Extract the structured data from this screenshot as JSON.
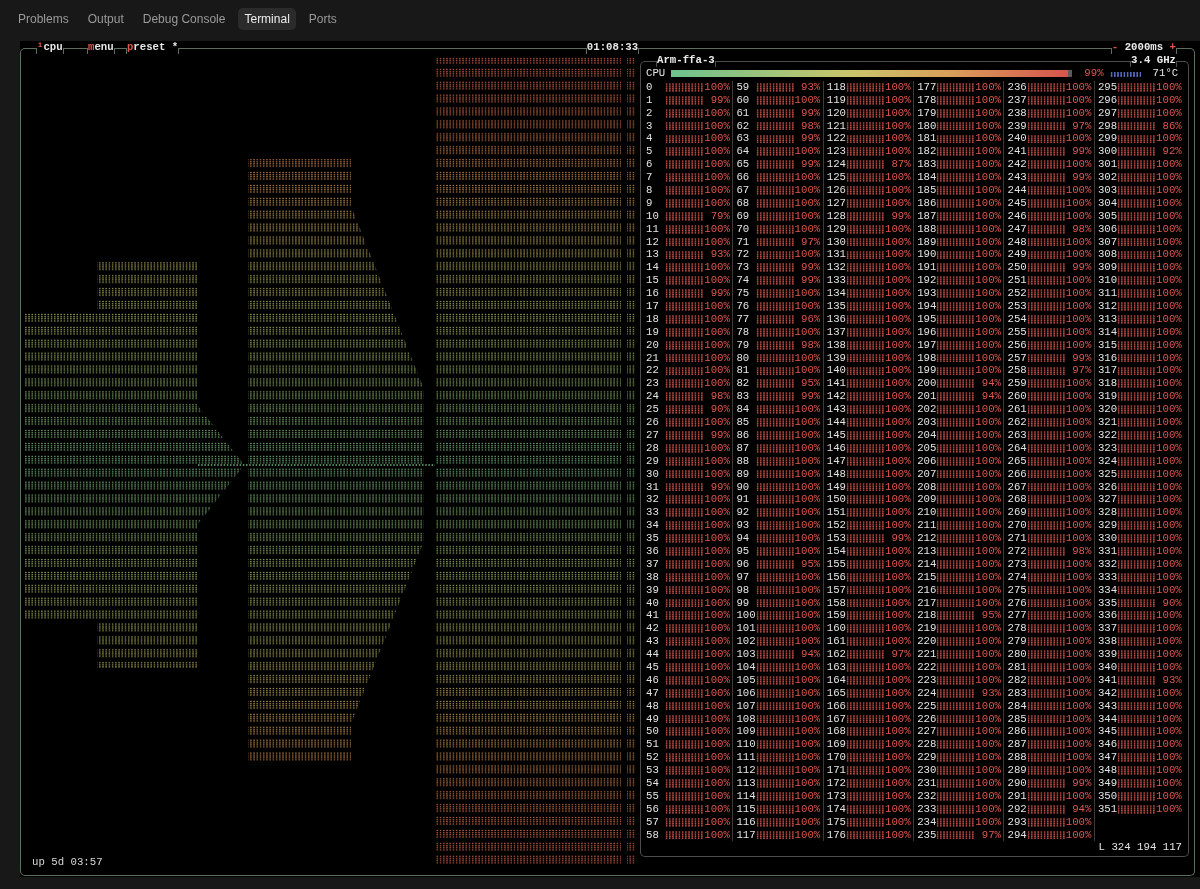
{
  "panel_tabs": [
    {
      "label": "Problems",
      "selected": false
    },
    {
      "label": "Output",
      "selected": false
    },
    {
      "label": "Debug Console",
      "selected": false
    },
    {
      "label": "Terminal",
      "selected": true
    },
    {
      "label": "Ports",
      "selected": false
    }
  ],
  "btop": {
    "title_tabs": [
      {
        "label": "¹cpu"
      },
      {
        "label": "menu"
      },
      {
        "label": "preset *"
      }
    ],
    "clock": "01:08:33",
    "update_interval": {
      "decrease": "-",
      "value": "2000ms",
      "increase": "+"
    },
    "uptime": "up 5d 03:57",
    "cpu_box": {
      "title": "Arm-ffa-3",
      "frequency": "3.4 GHz",
      "total": {
        "label": "CPU",
        "level": 0.99,
        "reading": "99%",
        "temperature": "71°C"
      },
      "cores": [
        {
          "label": "0",
          "reading": "100%"
        },
        {
          "label": "1",
          "reading": "99%"
        },
        {
          "label": "2",
          "reading": "100%"
        },
        {
          "label": "3",
          "reading": "100%"
        },
        {
          "label": "4",
          "reading": "100%"
        },
        {
          "label": "5",
          "reading": "100%"
        },
        {
          "label": "6",
          "reading": "100%"
        },
        {
          "label": "7",
          "reading": "100%"
        },
        {
          "label": "8",
          "reading": "100%"
        },
        {
          "label": "9",
          "reading": "100%"
        },
        {
          "label": "10",
          "reading": "79%"
        },
        {
          "label": "11",
          "reading": "100%"
        },
        {
          "label": "12",
          "reading": "100%"
        },
        {
          "label": "13",
          "reading": "93%"
        },
        {
          "label": "14",
          "reading": "100%"
        },
        {
          "label": "15",
          "reading": "100%"
        },
        {
          "label": "16",
          "reading": "99%"
        },
        {
          "label": "17",
          "reading": "100%"
        },
        {
          "label": "18",
          "reading": "100%"
        },
        {
          "label": "19",
          "reading": "100%"
        },
        {
          "label": "20",
          "reading": "100%"
        },
        {
          "label": "21",
          "reading": "100%"
        },
        {
          "label": "22",
          "reading": "100%"
        },
        {
          "label": "23",
          "reading": "100%"
        },
        {
          "label": "24",
          "reading": "98%"
        },
        {
          "label": "25",
          "reading": "90%"
        },
        {
          "label": "26",
          "reading": "100%"
        },
        {
          "label": "27",
          "reading": "99%"
        },
        {
          "label": "28",
          "reading": "100%"
        },
        {
          "label": "29",
          "reading": "100%"
        },
        {
          "label": "30",
          "reading": "100%"
        },
        {
          "label": "31",
          "reading": "99%"
        },
        {
          "label": "32",
          "reading": "100%"
        },
        {
          "label": "33",
          "reading": "100%"
        },
        {
          "label": "34",
          "reading": "100%"
        },
        {
          "label": "35",
          "reading": "100%"
        },
        {
          "label": "36",
          "reading": "100%"
        },
        {
          "label": "37",
          "reading": "100%"
        },
        {
          "label": "38",
          "reading": "100%"
        },
        {
          "label": "39",
          "reading": "100%"
        },
        {
          "label": "40",
          "reading": "100%"
        },
        {
          "label": "41",
          "reading": "100%"
        },
        {
          "label": "42",
          "reading": "100%"
        },
        {
          "label": "43",
          "reading": "100%"
        },
        {
          "label": "44",
          "reading": "100%"
        },
        {
          "label": "45",
          "reading": "100%"
        },
        {
          "label": "46",
          "reading": "100%"
        },
        {
          "label": "47",
          "reading": "100%"
        },
        {
          "label": "48",
          "reading": "100%"
        },
        {
          "label": "49",
          "reading": "100%"
        },
        {
          "label": "50",
          "reading": "100%"
        },
        {
          "label": "51",
          "reading": "100%"
        },
        {
          "label": "52",
          "reading": "100%"
        },
        {
          "label": "53",
          "reading": "100%"
        },
        {
          "label": "54",
          "reading": "100%"
        },
        {
          "label": "55",
          "reading": "100%"
        },
        {
          "label": "56",
          "reading": "100%"
        },
        {
          "label": "57",
          "reading": "100%"
        },
        {
          "label": "58",
          "reading": "100%"
        },
        {
          "label": "59",
          "reading": "93%"
        },
        {
          "label": "60",
          "reading": "100%"
        },
        {
          "label": "61",
          "reading": "99%"
        },
        {
          "label": "62",
          "reading": "98%"
        },
        {
          "label": "63",
          "reading": "99%"
        },
        {
          "label": "64",
          "reading": "100%"
        },
        {
          "label": "65",
          "reading": "99%"
        },
        {
          "label": "66",
          "reading": "100%"
        },
        {
          "label": "67",
          "reading": "100%"
        },
        {
          "label": "68",
          "reading": "100%"
        },
        {
          "label": "69",
          "reading": "100%"
        },
        {
          "label": "70",
          "reading": "100%"
        },
        {
          "label": "71",
          "reading": "97%"
        },
        {
          "label": "72",
          "reading": "100%"
        },
        {
          "label": "73",
          "reading": "99%"
        },
        {
          "label": "74",
          "reading": "99%"
        },
        {
          "label": "75",
          "reading": "100%"
        },
        {
          "label": "76",
          "reading": "100%"
        },
        {
          "label": "77",
          "reading": "96%"
        },
        {
          "label": "78",
          "reading": "100%"
        },
        {
          "label": "79",
          "reading": "98%"
        },
        {
          "label": "80",
          "reading": "100%"
        },
        {
          "label": "81",
          "reading": "100%"
        },
        {
          "label": "82",
          "reading": "95%"
        },
        {
          "label": "83",
          "reading": "99%"
        },
        {
          "label": "84",
          "reading": "100%"
        },
        {
          "label": "85",
          "reading": "100%"
        },
        {
          "label": "86",
          "reading": "100%"
        },
        {
          "label": "87",
          "reading": "100%"
        },
        {
          "label": "88",
          "reading": "100%"
        },
        {
          "label": "89",
          "reading": "100%"
        },
        {
          "label": "90",
          "reading": "100%"
        },
        {
          "label": "91",
          "reading": "100%"
        },
        {
          "label": "92",
          "reading": "100%"
        },
        {
          "label": "93",
          "reading": "100%"
        },
        {
          "label": "94",
          "reading": "100%"
        },
        {
          "label": "95",
          "reading": "100%"
        },
        {
          "label": "96",
          "reading": "95%"
        },
        {
          "label": "97",
          "reading": "100%"
        },
        {
          "label": "98",
          "reading": "100%"
        },
        {
          "label": "99",
          "reading": "100%"
        },
        {
          "label": "100",
          "reading": "100%"
        },
        {
          "label": "101",
          "reading": "100%"
        },
        {
          "label": "102",
          "reading": "100%"
        },
        {
          "label": "103",
          "reading": "94%"
        },
        {
          "label": "104",
          "reading": "100%"
        },
        {
          "label": "105",
          "reading": "100%"
        },
        {
          "label": "106",
          "reading": "100%"
        },
        {
          "label": "107",
          "reading": "100%"
        },
        {
          "label": "108",
          "reading": "100%"
        },
        {
          "label": "109",
          "reading": "100%"
        },
        {
          "label": "110",
          "reading": "100%"
        },
        {
          "label": "111",
          "reading": "100%"
        },
        {
          "label": "112",
          "reading": "100%"
        },
        {
          "label": "113",
          "reading": "100%"
        },
        {
          "label": "114",
          "reading": "100%"
        },
        {
          "label": "115",
          "reading": "100%"
        },
        {
          "label": "116",
          "reading": "100%"
        },
        {
          "label": "117",
          "reading": "100%"
        },
        {
          "label": "118",
          "reading": "100%"
        },
        {
          "label": "119",
          "reading": "100%"
        },
        {
          "label": "120",
          "reading": "100%"
        },
        {
          "label": "121",
          "reading": "100%"
        },
        {
          "label": "122",
          "reading": "100%"
        },
        {
          "label": "123",
          "reading": "100%"
        },
        {
          "label": "124",
          "reading": "87%"
        },
        {
          "label": "125",
          "reading": "100%"
        },
        {
          "label": "126",
          "reading": "100%"
        },
        {
          "label": "127",
          "reading": "100%"
        },
        {
          "label": "128",
          "reading": "99%"
        },
        {
          "label": "129",
          "reading": "100%"
        },
        {
          "label": "130",
          "reading": "100%"
        },
        {
          "label": "131",
          "reading": "100%"
        },
        {
          "label": "132",
          "reading": "100%"
        },
        {
          "label": "133",
          "reading": "100%"
        },
        {
          "label": "134",
          "reading": "100%"
        },
        {
          "label": "135",
          "reading": "100%"
        },
        {
          "label": "136",
          "reading": "100%"
        },
        {
          "label": "137",
          "reading": "100%"
        },
        {
          "label": "138",
          "reading": "100%"
        },
        {
          "label": "139",
          "reading": "100%"
        },
        {
          "label": "140",
          "reading": "100%"
        },
        {
          "label": "141",
          "reading": "100%"
        },
        {
          "label": "142",
          "reading": "100%"
        },
        {
          "label": "143",
          "reading": "100%"
        },
        {
          "label": "144",
          "reading": "100%"
        },
        {
          "label": "145",
          "reading": "100%"
        },
        {
          "label": "146",
          "reading": "100%"
        },
        {
          "label": "147",
          "reading": "100%"
        },
        {
          "label": "148",
          "reading": "100%"
        },
        {
          "label": "149",
          "reading": "100%"
        },
        {
          "label": "150",
          "reading": "100%"
        },
        {
          "label": "151",
          "reading": "100%"
        },
        {
          "label": "152",
          "reading": "100%"
        },
        {
          "label": "153",
          "reading": "99%"
        },
        {
          "label": "154",
          "reading": "100%"
        },
        {
          "label": "155",
          "reading": "100%"
        },
        {
          "label": "156",
          "reading": "100%"
        },
        {
          "label": "157",
          "reading": "100%"
        },
        {
          "label": "158",
          "reading": "100%"
        },
        {
          "label": "159",
          "reading": "100%"
        },
        {
          "label": "160",
          "reading": "100%"
        },
        {
          "label": "161",
          "reading": "100%"
        },
        {
          "label": "162",
          "reading": "97%"
        },
        {
          "label": "163",
          "reading": "100%"
        },
        {
          "label": "164",
          "reading": "100%"
        },
        {
          "label": "165",
          "reading": "100%"
        },
        {
          "label": "166",
          "reading": "100%"
        },
        {
          "label": "167",
          "reading": "100%"
        },
        {
          "label": "168",
          "reading": "100%"
        },
        {
          "label": "169",
          "reading": "100%"
        },
        {
          "label": "170",
          "reading": "100%"
        },
        {
          "label": "171",
          "reading": "100%"
        },
        {
          "label": "172",
          "reading": "100%"
        },
        {
          "label": "173",
          "reading": "100%"
        },
        {
          "label": "174",
          "reading": "100%"
        },
        {
          "label": "175",
          "reading": "100%"
        },
        {
          "label": "176",
          "reading": "100%"
        },
        {
          "label": "177",
          "reading": "100%"
        },
        {
          "label": "178",
          "reading": "100%"
        },
        {
          "label": "179",
          "reading": "100%"
        },
        {
          "label": "180",
          "reading": "100%"
        },
        {
          "label": "181",
          "reading": "100%"
        },
        {
          "label": "182",
          "reading": "100%"
        },
        {
          "label": "183",
          "reading": "100%"
        },
        {
          "label": "184",
          "reading": "100%"
        },
        {
          "label": "185",
          "reading": "100%"
        },
        {
          "label": "186",
          "reading": "100%"
        },
        {
          "label": "187",
          "reading": "100%"
        },
        {
          "label": "188",
          "reading": "100%"
        },
        {
          "label": "189",
          "reading": "100%"
        },
        {
          "label": "190",
          "reading": "100%"
        },
        {
          "label": "191",
          "reading": "100%"
        },
        {
          "label": "192",
          "reading": "100%"
        },
        {
          "label": "193",
          "reading": "100%"
        },
        {
          "label": "194",
          "reading": "100%"
        },
        {
          "label": "195",
          "reading": "100%"
        },
        {
          "label": "196",
          "reading": "100%"
        },
        {
          "label": "197",
          "reading": "100%"
        },
        {
          "label": "198",
          "reading": "100%"
        },
        {
          "label": "199",
          "reading": "100%"
        },
        {
          "label": "200",
          "reading": "94%"
        },
        {
          "label": "201",
          "reading": "94%"
        },
        {
          "label": "202",
          "reading": "100%"
        },
        {
          "label": "203",
          "reading": "100%"
        },
        {
          "label": "204",
          "reading": "100%"
        },
        {
          "label": "205",
          "reading": "100%"
        },
        {
          "label": "206",
          "reading": "100%"
        },
        {
          "label": "207",
          "reading": "100%"
        },
        {
          "label": "208",
          "reading": "100%"
        },
        {
          "label": "209",
          "reading": "100%"
        },
        {
          "label": "210",
          "reading": "100%"
        },
        {
          "label": "211",
          "reading": "100%"
        },
        {
          "label": "212",
          "reading": "100%"
        },
        {
          "label": "213",
          "reading": "100%"
        },
        {
          "label": "214",
          "reading": "100%"
        },
        {
          "label": "215",
          "reading": "100%"
        },
        {
          "label": "216",
          "reading": "100%"
        },
        {
          "label": "217",
          "reading": "100%"
        },
        {
          "label": "218",
          "reading": "95%"
        },
        {
          "label": "219",
          "reading": "100%"
        },
        {
          "label": "220",
          "reading": "100%"
        },
        {
          "label": "221",
          "reading": "100%"
        },
        {
          "label": "222",
          "reading": "100%"
        },
        {
          "label": "223",
          "reading": "100%"
        },
        {
          "label": "224",
          "reading": "93%"
        },
        {
          "label": "225",
          "reading": "100%"
        },
        {
          "label": "226",
          "reading": "100%"
        },
        {
          "label": "227",
          "reading": "100%"
        },
        {
          "label": "228",
          "reading": "100%"
        },
        {
          "label": "229",
          "reading": "100%"
        },
        {
          "label": "230",
          "reading": "100%"
        },
        {
          "label": "231",
          "reading": "100%"
        },
        {
          "label": "232",
          "reading": "100%"
        },
        {
          "label": "233",
          "reading": "100%"
        },
        {
          "label": "234",
          "reading": "100%"
        },
        {
          "label": "235",
          "reading": "97%"
        },
        {
          "label": "236",
          "reading": "100%"
        },
        {
          "label": "237",
          "reading": "100%"
        },
        {
          "label": "238",
          "reading": "100%"
        },
        {
          "label": "239",
          "reading": "97%"
        },
        {
          "label": "240",
          "reading": "100%"
        },
        {
          "label": "241",
          "reading": "99%"
        },
        {
          "label": "242",
          "reading": "100%"
        },
        {
          "label": "243",
          "reading": "99%"
        },
        {
          "label": "244",
          "reading": "100%"
        },
        {
          "label": "245",
          "reading": "100%"
        },
        {
          "label": "246",
          "reading": "100%"
        },
        {
          "label": "247",
          "reading": "98%"
        },
        {
          "label": "248",
          "reading": "100%"
        },
        {
          "label": "249",
          "reading": "100%"
        },
        {
          "label": "250",
          "reading": "99%"
        },
        {
          "label": "251",
          "reading": "100%"
        },
        {
          "label": "252",
          "reading": "100%"
        },
        {
          "label": "253",
          "reading": "100%"
        },
        {
          "label": "254",
          "reading": "100%"
        },
        {
          "label": "255",
          "reading": "100%"
        },
        {
          "label": "256",
          "reading": "100%"
        },
        {
          "label": "257",
          "reading": "99%"
        },
        {
          "label": "258",
          "reading": "97%"
        },
        {
          "label": "259",
          "reading": "100%"
        },
        {
          "label": "260",
          "reading": "100%"
        },
        {
          "label": "261",
          "reading": "100%"
        },
        {
          "label": "262",
          "reading": "100%"
        },
        {
          "label": "263",
          "reading": "100%"
        },
        {
          "label": "264",
          "reading": "100%"
        },
        {
          "label": "265",
          "reading": "100%"
        },
        {
          "label": "266",
          "reading": "100%"
        },
        {
          "label": "267",
          "reading": "100%"
        },
        {
          "label": "268",
          "reading": "100%"
        },
        {
          "label": "269",
          "reading": "100%"
        },
        {
          "label": "270",
          "reading": "100%"
        },
        {
          "label": "271",
          "reading": "100%"
        },
        {
          "label": "272",
          "reading": "98%"
        },
        {
          "label": "273",
          "reading": "100%"
        },
        {
          "label": "274",
          "reading": "100%"
        },
        {
          "label": "275",
          "reading": "100%"
        },
        {
          "label": "276",
          "reading": "100%"
        },
        {
          "label": "277",
          "reading": "100%"
        },
        {
          "label": "278",
          "reading": "100%"
        },
        {
          "label": "279",
          "reading": "100%"
        },
        {
          "label": "280",
          "reading": "100%"
        },
        {
          "label": "281",
          "reading": "100%"
        },
        {
          "label": "282",
          "reading": "100%"
        },
        {
          "label": "283",
          "reading": "100%"
        },
        {
          "label": "284",
          "reading": "100%"
        },
        {
          "label": "285",
          "reading": "100%"
        },
        {
          "label": "286",
          "reading": "100%"
        },
        {
          "label": "287",
          "reading": "100%"
        },
        {
          "label": "288",
          "reading": "100%"
        },
        {
          "label": "289",
          "reading": "100%"
        },
        {
          "label": "290",
          "reading": "99%"
        },
        {
          "label": "291",
          "reading": "100%"
        },
        {
          "label": "292",
          "reading": "94%"
        },
        {
          "label": "293",
          "reading": "100%"
        },
        {
          "label": "294",
          "reading": "100%"
        },
        {
          "label": "295",
          "reading": "100%"
        },
        {
          "label": "296",
          "reading": "100%"
        },
        {
          "label": "297",
          "reading": "100%"
        },
        {
          "label": "298",
          "reading": "86%"
        },
        {
          "label": "299",
          "reading": "100%"
        },
        {
          "label": "300",
          "reading": "92%"
        },
        {
          "label": "301",
          "reading": "100%"
        },
        {
          "label": "302",
          "reading": "100%"
        },
        {
          "label": "303",
          "reading": "100%"
        },
        {
          "label": "304",
          "reading": "100%"
        },
        {
          "label": "305",
          "reading": "100%"
        },
        {
          "label": "306",
          "reading": "100%"
        },
        {
          "label": "307",
          "reading": "100%"
        },
        {
          "label": "308",
          "reading": "100%"
        },
        {
          "label": "309",
          "reading": "100%"
        },
        {
          "label": "310",
          "reading": "100%"
        },
        {
          "label": "311",
          "reading": "100%"
        },
        {
          "label": "312",
          "reading": "100%"
        },
        {
          "label": "313",
          "reading": "100%"
        },
        {
          "label": "314",
          "reading": "100%"
        },
        {
          "label": "315",
          "reading": "100%"
        },
        {
          "label": "316",
          "reading": "100%"
        },
        {
          "label": "317",
          "reading": "100%"
        },
        {
          "label": "318",
          "reading": "100%"
        },
        {
          "label": "319",
          "reading": "100%"
        },
        {
          "label": "320",
          "reading": "100%"
        },
        {
          "label": "321",
          "reading": "100%"
        },
        {
          "label": "322",
          "reading": "100%"
        },
        {
          "label": "323",
          "reading": "100%"
        },
        {
          "label": "324",
          "reading": "100%"
        },
        {
          "label": "325",
          "reading": "100%"
        },
        {
          "label": "326",
          "reading": "100%"
        },
        {
          "label": "327",
          "reading": "100%"
        },
        {
          "label": "328",
          "reading": "100%"
        },
        {
          "label": "329",
          "reading": "100%"
        },
        {
          "label": "330",
          "reading": "100%"
        },
        {
          "label": "331",
          "reading": "100%"
        },
        {
          "label": "332",
          "reading": "100%"
        },
        {
          "label": "333",
          "reading": "100%"
        },
        {
          "label": "334",
          "reading": "100%"
        },
        {
          "label": "335",
          "reading": "90%"
        },
        {
          "label": "336",
          "reading": "100%"
        },
        {
          "label": "337",
          "reading": "100%"
        },
        {
          "label": "338",
          "reading": "100%"
        },
        {
          "label": "339",
          "reading": "100%"
        },
        {
          "label": "340",
          "reading": "100%"
        },
        {
          "label": "341",
          "reading": "93%"
        },
        {
          "label": "342",
          "reading": "100%"
        },
        {
          "label": "343",
          "reading": "100%"
        },
        {
          "label": "344",
          "reading": "100%"
        },
        {
          "label": "345",
          "reading": "100%"
        },
        {
          "label": "346",
          "reading": "100%"
        },
        {
          "label": "347",
          "reading": "100%"
        },
        {
          "label": "348",
          "reading": "100%"
        },
        {
          "label": "349",
          "reading": "100%"
        },
        {
          "label": "350",
          "reading": "100%"
        },
        {
          "label": "351",
          "reading": "100%"
        }
      ],
      "load_average": "L 324 194 117"
    }
  }
}
